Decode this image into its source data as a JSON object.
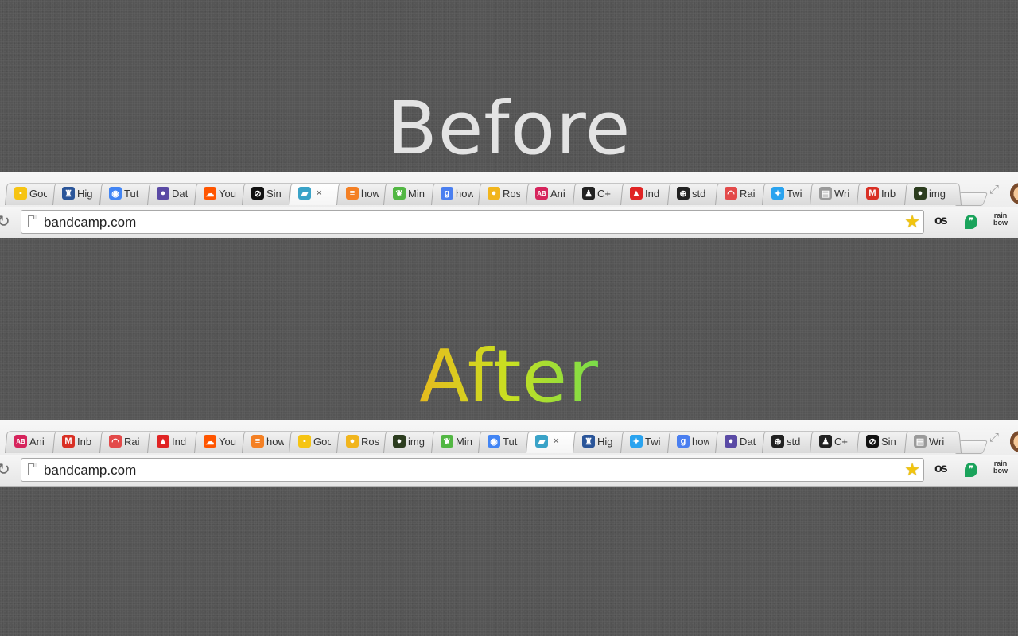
{
  "headings": {
    "before": "Before",
    "after": "After"
  },
  "before": {
    "tabs": [
      {
        "title": "Goo",
        "icon": "keep-icon",
        "color": "#f6c413",
        "glyph": "▪"
      },
      {
        "title": "Hig",
        "icon": "highrise-icon",
        "color": "#2a5599",
        "glyph": "♜"
      },
      {
        "title": "Tut",
        "icon": "chrome-icon",
        "color": "#4285f4",
        "glyph": "◉"
      },
      {
        "title": "Dat",
        "icon": "orb-icon",
        "color": "#5a4aa5",
        "glyph": "●"
      },
      {
        "title": "You",
        "icon": "soundcloud-icon",
        "color": "#ff5500",
        "glyph": "☁"
      },
      {
        "title": "Sin",
        "icon": "circle-slash-icon",
        "color": "#111111",
        "glyph": "⊘"
      },
      {
        "title": "",
        "icon": "parallelogram-icon",
        "color": "#3aa3c8",
        "glyph": "▰",
        "active": true,
        "close": "×"
      },
      {
        "title": "how",
        "icon": "stackoverflow-icon",
        "color": "#f48024",
        "glyph": "≡"
      },
      {
        "title": "Min",
        "icon": "leaf-icon",
        "color": "#52b743",
        "glyph": "❦"
      },
      {
        "title": "how",
        "icon": "google-icon",
        "color": "#4a7ff0",
        "glyph": "g"
      },
      {
        "title": "Ros",
        "icon": "rosetta-icon",
        "color": "#f1b51d",
        "glyph": "●"
      },
      {
        "title": "Ani",
        "icon": "ab-icon",
        "color": "#d6245c",
        "glyph": "AB"
      },
      {
        "title": "C+",
        "icon": "linux-penguin-icon",
        "color": "#222222",
        "glyph": "♟"
      },
      {
        "title": "Ind",
        "icon": "indie-icon",
        "color": "#e02424",
        "glyph": "▲"
      },
      {
        "title": "std",
        "icon": "cplusplus-icon",
        "color": "#222222",
        "glyph": "⊕"
      },
      {
        "title": "Rai",
        "icon": "rainbow-icon",
        "color": "#e34a4a",
        "glyph": "◠"
      },
      {
        "title": "Twi",
        "icon": "twitter-icon",
        "color": "#2aa3ef",
        "glyph": "✦"
      },
      {
        "title": "Wri",
        "icon": "document-icon",
        "color": "#9a9a9a",
        "glyph": "▤"
      },
      {
        "title": "Inb",
        "icon": "gmail-icon",
        "color": "#d93025",
        "glyph": "M"
      },
      {
        "title": "img",
        "icon": "imgur-icon",
        "color": "#2c3d1f",
        "glyph": "●"
      }
    ],
    "url": "bandcamp.com"
  },
  "after": {
    "tabs": [
      {
        "title": "Ani",
        "icon": "ab-icon",
        "color": "#d6245c",
        "glyph": "AB"
      },
      {
        "title": "Inb",
        "icon": "gmail-icon",
        "color": "#d93025",
        "glyph": "M"
      },
      {
        "title": "Rai",
        "icon": "rainbow-icon",
        "color": "#e34a4a",
        "glyph": "◠"
      },
      {
        "title": "Ind",
        "icon": "indie-icon",
        "color": "#e02424",
        "glyph": "▲"
      },
      {
        "title": "You",
        "icon": "soundcloud-icon",
        "color": "#ff5500",
        "glyph": "☁"
      },
      {
        "title": "how",
        "icon": "stackoverflow-icon",
        "color": "#f48024",
        "glyph": "≡"
      },
      {
        "title": "Goo",
        "icon": "keep-icon",
        "color": "#f6c413",
        "glyph": "▪"
      },
      {
        "title": "Ros",
        "icon": "rosetta-icon",
        "color": "#f1b51d",
        "glyph": "●"
      },
      {
        "title": "img",
        "icon": "imgur-icon",
        "color": "#2c3d1f",
        "glyph": "●"
      },
      {
        "title": "Min",
        "icon": "leaf-icon",
        "color": "#52b743",
        "glyph": "❦"
      },
      {
        "title": "Tut",
        "icon": "chrome-icon",
        "color": "#4285f4",
        "glyph": "◉"
      },
      {
        "title": "",
        "icon": "parallelogram-icon",
        "color": "#3aa3c8",
        "glyph": "▰",
        "active": true,
        "close": "×"
      },
      {
        "title": "Hig",
        "icon": "highrise-icon",
        "color": "#2a5599",
        "glyph": "♜"
      },
      {
        "title": "Twi",
        "icon": "twitter-icon",
        "color": "#2aa3ef",
        "glyph": "✦"
      },
      {
        "title": "how",
        "icon": "google-icon",
        "color": "#4a7ff0",
        "glyph": "g"
      },
      {
        "title": "Dat",
        "icon": "orb-icon",
        "color": "#5a4aa5",
        "glyph": "●"
      },
      {
        "title": "std",
        "icon": "cplusplus-icon",
        "color": "#222222",
        "glyph": "⊕"
      },
      {
        "title": "C+",
        "icon": "linux-penguin-icon",
        "color": "#222222",
        "glyph": "♟"
      },
      {
        "title": "Sin",
        "icon": "circle-slash-icon",
        "color": "#111111",
        "glyph": "⊘"
      },
      {
        "title": "Wri",
        "icon": "document-icon",
        "color": "#9a9a9a",
        "glyph": "▤"
      }
    ],
    "url": "bandcamp.com"
  },
  "extensions": {
    "lastfm_label": "os",
    "hangouts_label": "❞",
    "rainbow_label_1": "rain",
    "rainbow_label_2": "bow"
  },
  "icons": {
    "reload": "↻",
    "star": "★",
    "expand": "⤢"
  }
}
